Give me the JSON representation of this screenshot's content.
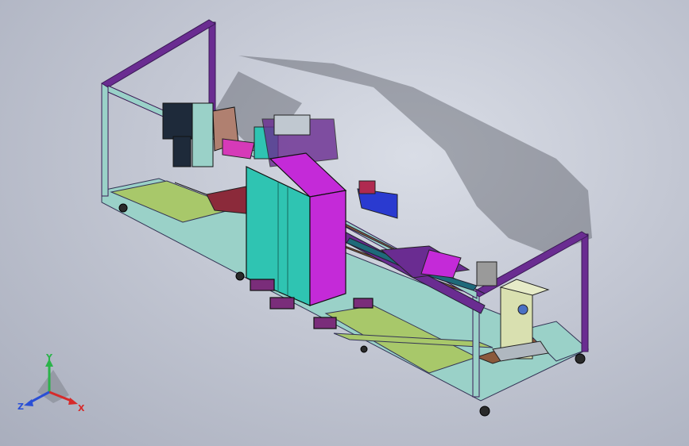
{
  "viewport": {
    "background_top": "#d9dde6",
    "background_bottom": "#a9aebd"
  },
  "model": {
    "frame_color": "#6a2c91",
    "rail_color": "#9ad1c8",
    "base_plate_color": "#a8c86a",
    "cabinet_color": "#2fc4b2",
    "cabinet_top_color": "#c42ad8",
    "wood_color": "#8b5a3c",
    "motor_color": "#1e2a3a"
  },
  "triad": {
    "y_label": "Y",
    "z_label": "Z",
    "x_label": "X",
    "y_color": "#2bb34a",
    "z_color": "#2a4fd6",
    "x_color": "#d62a2a"
  }
}
